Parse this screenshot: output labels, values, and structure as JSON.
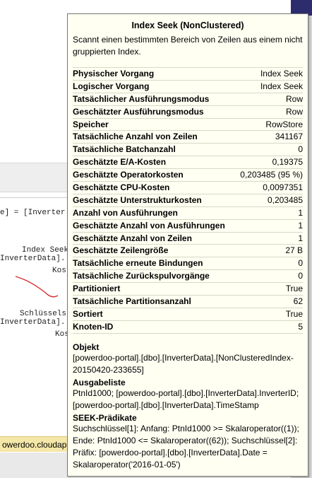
{
  "tooltip": {
    "title": "Index Seek (NonClustered)",
    "description": "Scannt einen bestimmten Bereich von Zeilen aus einem nicht gruppierten Index.",
    "properties": [
      {
        "label": "Physischer Vorgang",
        "value": "Index Seek"
      },
      {
        "label": "Logischer Vorgang",
        "value": "Index Seek"
      },
      {
        "label": "Tatsächlicher Ausführungsmodus",
        "value": "Row"
      },
      {
        "label": "Geschätzter Ausführungsmodus",
        "value": "Row"
      },
      {
        "label": "Speicher",
        "value": "RowStore"
      },
      {
        "label": "Tatsächliche Anzahl von Zeilen",
        "value": "341167"
      },
      {
        "label": "Tatsächliche Batchanzahl",
        "value": "0"
      },
      {
        "label": "Geschätzte E/A-Kosten",
        "value": "0,19375"
      },
      {
        "label": "Geschätzte Operatorkosten",
        "value": "0,203485 (95 %)"
      },
      {
        "label": "Geschätzte CPU-Kosten",
        "value": "0,0097351"
      },
      {
        "label": "Geschätzte Unterstrukturkosten",
        "value": "0,203485"
      },
      {
        "label": "Anzahl von Ausführungen",
        "value": "1"
      },
      {
        "label": "Geschätzte Anzahl von Ausführungen",
        "value": "1"
      },
      {
        "label": "Geschätzte Anzahl von Zeilen",
        "value": "1"
      },
      {
        "label": "Geschätzte Zeilengröße",
        "value": "27 B"
      },
      {
        "label": "Tatsächliche erneute Bindungen",
        "value": "0"
      },
      {
        "label": "Tatsächliche Zurückspulvorgänge",
        "value": "0"
      },
      {
        "label": "Partitioniert",
        "value": "True"
      },
      {
        "label": "Tatsächliche Partitionsanzahl",
        "value": "62"
      },
      {
        "label": "Sortiert",
        "value": "True"
      },
      {
        "label": "Knoten-ID",
        "value": "5"
      }
    ],
    "sections": [
      {
        "heading": "Objekt",
        "text": "[powerdoo-portal].[dbo].[InverterData].[NonClusteredIndex-20150420-233655]"
      },
      {
        "heading": "Ausgabeliste",
        "text": "PtnId1000; [powerdoo-portal].[dbo].[InverterData].InverterID; [powerdoo-portal].[dbo].[InverterData].TimeStamp"
      },
      {
        "heading": "SEEK-Prädikate",
        "text": "Suchschlüssel[1]: Anfang: PtnId1000 >= Skalaroperator((1)); Ende: PtnId1000 <= Skalaroperator((62)); Suchschlüssel[2]: Präfix: [powerdoo-portal].[dbo].[InverterData].Date = Skalaroperator('2016-01-05')"
      }
    ]
  },
  "background": {
    "query_fragment": "e] = [Inverter",
    "node1_name": "Index Seek",
    "node1_table": "InverterData].",
    "node1_cost": "Kost",
    "node2_name": "Schlüsselsu",
    "node2_table": "InverterData].",
    "node2_cost": "Kos",
    "status_text": "owerdoo.cloudapp."
  }
}
